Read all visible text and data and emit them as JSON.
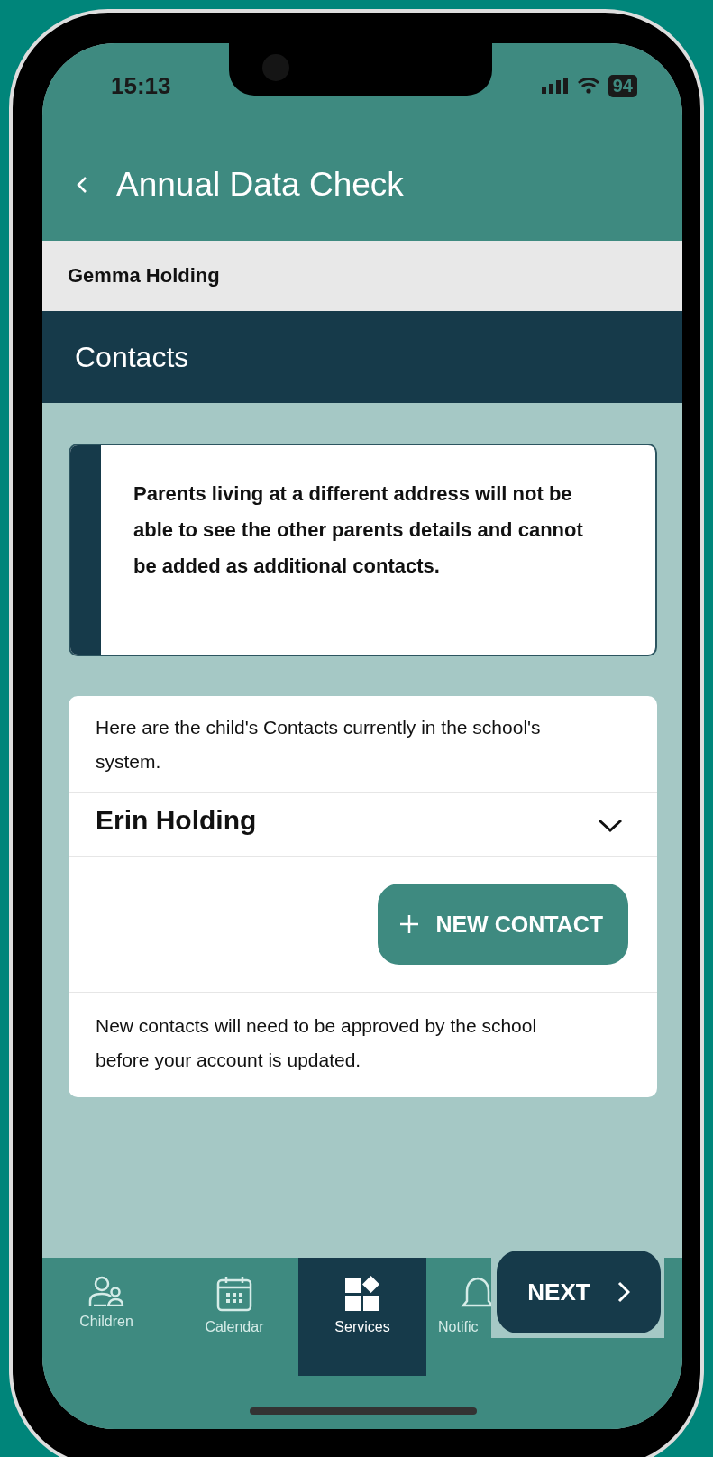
{
  "status_bar": {
    "time": "15:13",
    "battery": "94"
  },
  "header": {
    "title": "Annual Data Check"
  },
  "student": {
    "name": "Gemma Holding"
  },
  "section": {
    "title": "Contacts"
  },
  "notice": {
    "text": "Parents living at a different address will not be able to see the other parents details and cannot be added as additional contacts."
  },
  "contacts_card": {
    "intro": "Here are the child's Contacts currently in the school's system.",
    "contacts": [
      {
        "name": "Erin Holding",
        "expanded": false
      }
    ],
    "new_contact_button": "NEW CONTACT",
    "footnote": "New contacts will need to be approved by the school before your account is updated."
  },
  "bottom_nav": [
    {
      "label": "Children",
      "kind": "people",
      "selected": false
    },
    {
      "label": "Calendar",
      "kind": "calendar",
      "selected": false
    },
    {
      "label": "Services",
      "kind": "services",
      "selected": true
    },
    {
      "label": "Notific",
      "kind": "bell",
      "selected": false
    }
  ],
  "next_button": "NEXT"
}
